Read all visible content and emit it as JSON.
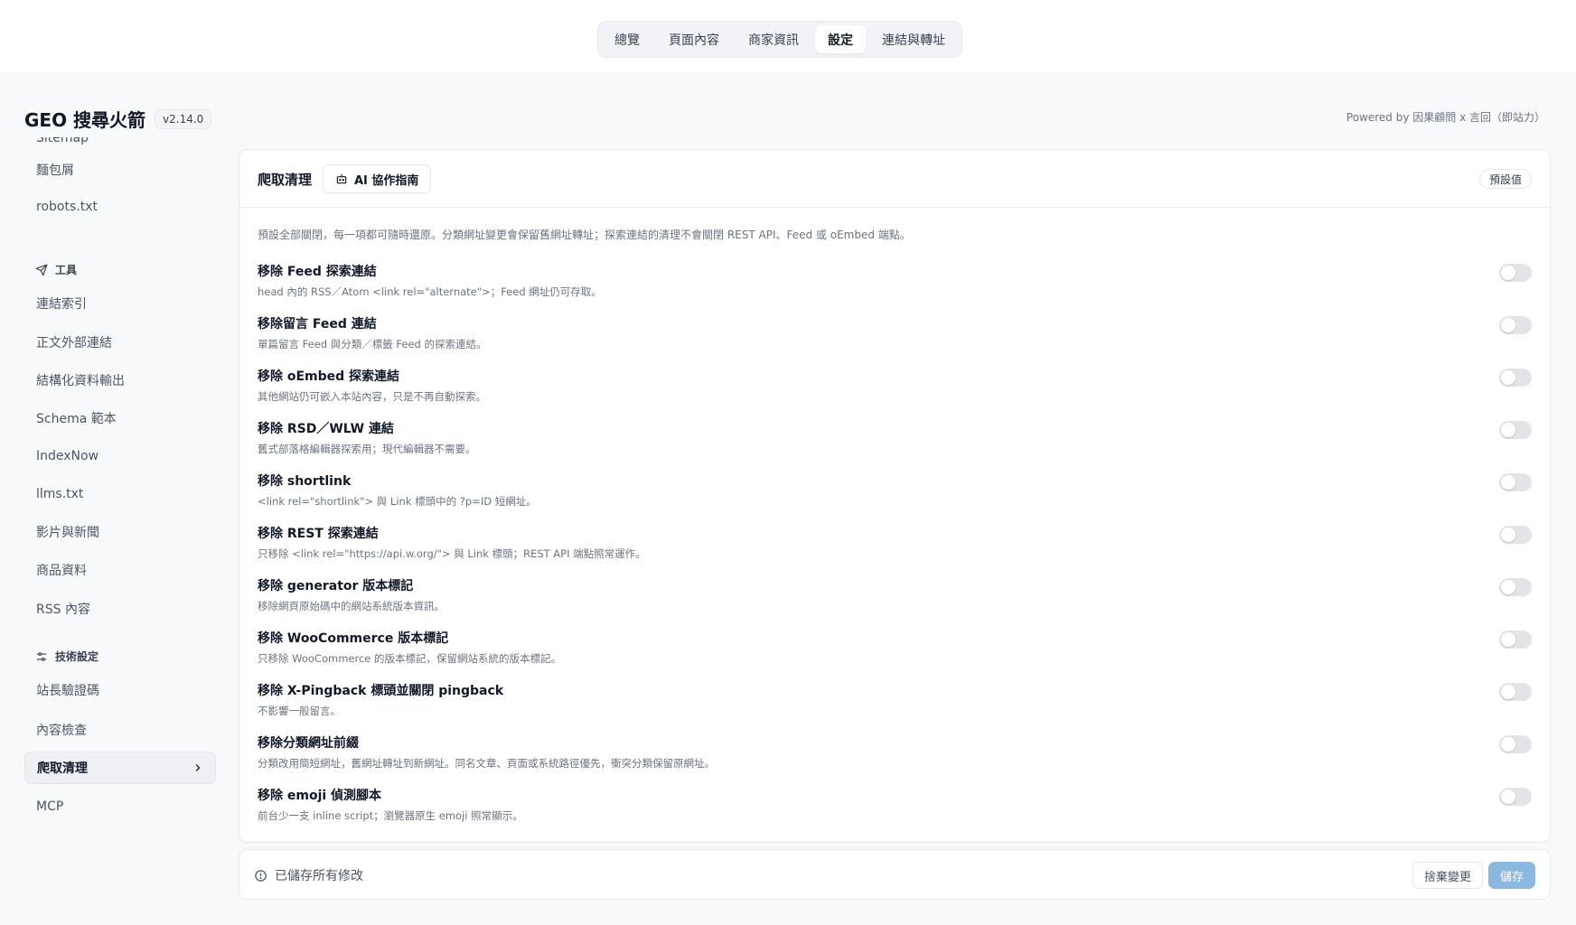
{
  "nav": {
    "tabs": [
      "總覽",
      "頁面內容",
      "商家資訊",
      "設定",
      "連結與轉址"
    ],
    "active_tab": "設定"
  },
  "brand": {
    "title": "GEO 搜尋火箭",
    "version": "v2.14.0"
  },
  "powered_by": "Powered by 因果顧問 x 言回（即站力）",
  "sidebar": {
    "top_items": [
      "Sitemap",
      "麵包屑",
      "robots.txt"
    ],
    "tools_label": "工具",
    "tools_items": [
      "連結索引",
      "正文外部連結",
      "結構化資料輸出",
      "Schema 範本",
      "IndexNow",
      "llms.txt",
      "影片與新聞",
      "商品資料",
      "RSS 內容"
    ],
    "tech_label": "技術設定",
    "tech_items": [
      "站長驗證碼",
      "內容檢查",
      "爬取清理",
      "MCP"
    ],
    "active_item": "爬取清理"
  },
  "card": {
    "title": "爬取清理",
    "ai_button": "AI 協作指南",
    "default_button": "預設值",
    "intro": "預設全部關閉，每一項都可隨時還原。分類網址變更會保留舊網址轉址；探索連結的清理不會關閉 REST API、Feed 或 oEmbed 端點。",
    "options": [
      {
        "title": "移除 Feed 探索連結",
        "desc": "head 內的 RSS／Atom <link rel=\"alternate\">；Feed 網址仍可存取。",
        "enabled": false
      },
      {
        "title": "移除留言 Feed 連結",
        "desc": "單篇留言 Feed 與分類／標籤 Feed 的探索連結。",
        "enabled": false
      },
      {
        "title": "移除 oEmbed 探索連結",
        "desc": "其他網站仍可嵌入本站內容，只是不再自動探索。",
        "enabled": false
      },
      {
        "title": "移除 RSD／WLW 連結",
        "desc": "舊式部落格編輯器探索用；現代編輯器不需要。",
        "enabled": false
      },
      {
        "title": "移除 shortlink",
        "desc": "<link rel=\"shortlink\"> 與 Link 標頭中的 ?p=ID 短網址。",
        "enabled": false
      },
      {
        "title": "移除 REST 探索連結",
        "desc": "只移除 <link rel=\"https://api.w.org/\"> 與 Link 標頭；REST API 端點照常運作。",
        "enabled": false
      },
      {
        "title": "移除 generator 版本標記",
        "desc": "移除網頁原始碼中的網站系統版本資訊。",
        "enabled": false
      },
      {
        "title": "移除 WooCommerce 版本標記",
        "desc": "只移除 WooCommerce 的版本標記，保留網站系統的版本標記。",
        "enabled": false
      },
      {
        "title": "移除 X-Pingback 標頭並關閉 pingback",
        "desc": "不影響一般留言。",
        "enabled": false
      },
      {
        "title": "移除分類網址前綴",
        "desc": "分類改用簡短網址，舊網址轉址到新網址。同名文章、頁面或系統路徑優先，衝突分類保留原網址。",
        "enabled": false
      },
      {
        "title": "移除 emoji 偵測腳本",
        "desc": "前台少一支 inline script；瀏覽器原生 emoji 照常顯示。",
        "enabled": false
      }
    ]
  },
  "footer": {
    "status": "已儲存所有修改",
    "discard_button": "捨棄變更",
    "save_button": "儲存"
  },
  "colors": {
    "save_button": "#8ab8de",
    "toggle_off": "#e2e4e8"
  }
}
